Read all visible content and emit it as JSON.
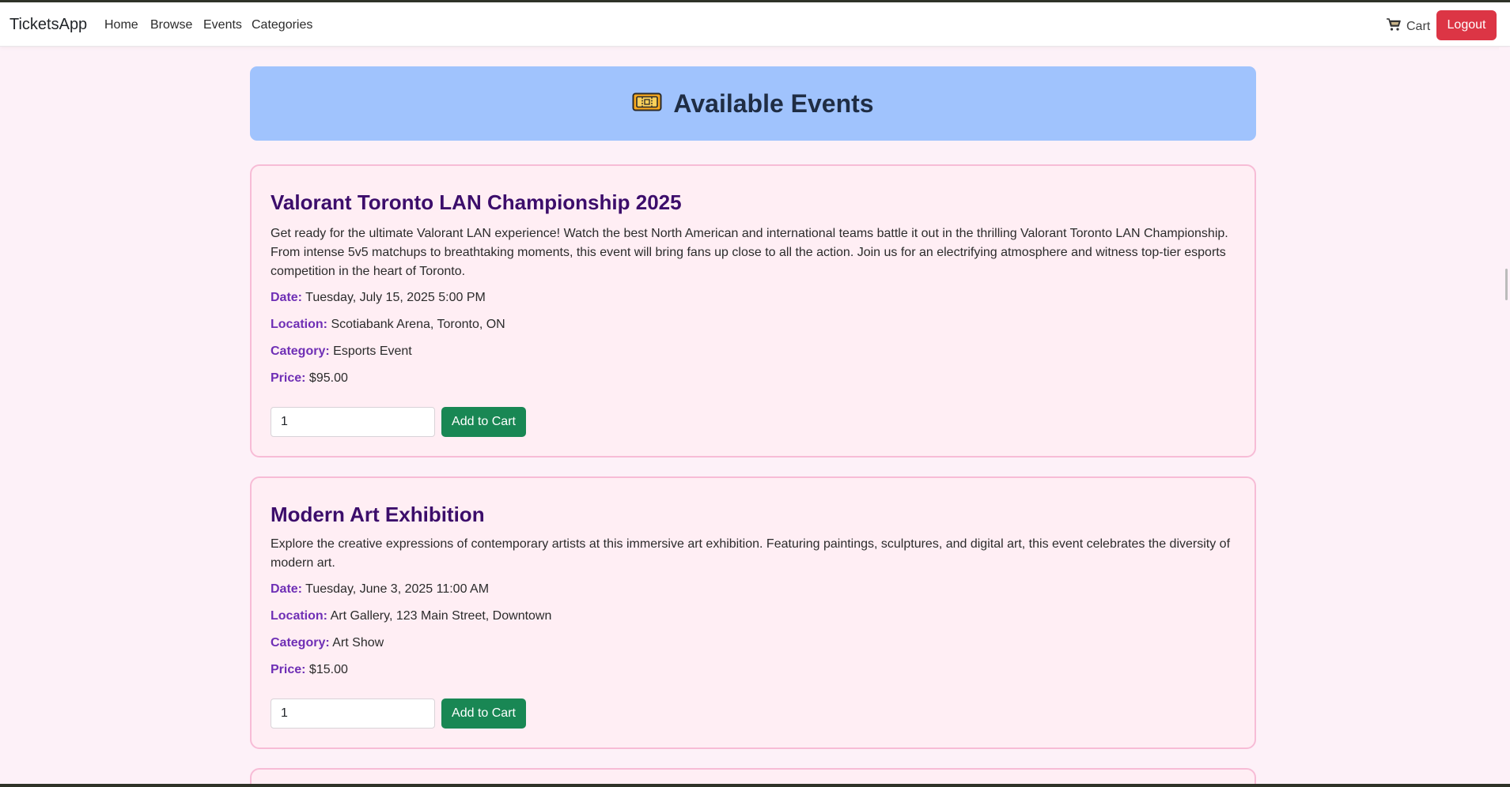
{
  "nav": {
    "brand": "TicketsApp",
    "links": [
      "Home",
      "Browse",
      "Events",
      "Categories"
    ],
    "cart_label": "Cart",
    "cart_icon": "cart-icon",
    "logout_label": "Logout"
  },
  "hero": {
    "icon": "ticket-icon",
    "title": "Available Events"
  },
  "labels": {
    "date": "Date:",
    "location": "Location:",
    "category": "Category:",
    "price": "Price:",
    "add_to_cart": "Add to Cart"
  },
  "events": [
    {
      "title": "Valorant Toronto LAN Championship 2025",
      "description": "Get ready for the ultimate Valorant LAN experience! Watch the best North American and international teams battle it out in the thrilling Valorant Toronto LAN Championship. From intense 5v5 matchups to breathtaking moments, this event will bring fans up close to all the action. Join us for an electrifying atmosphere and witness top-tier esports competition in the heart of Toronto.",
      "date": "Tuesday, July 15, 2025 5:00 PM",
      "location": "Scotiabank Arena, Toronto, ON",
      "category": "Esports Event",
      "price": "$95.00",
      "quantity": "1"
    },
    {
      "title": "Modern Art Exhibition",
      "description": "Explore the creative expressions of contemporary artists at this immersive art exhibition. Featuring paintings, sculptures, and digital art, this event celebrates the diversity of modern art.",
      "date": "Tuesday, June 3, 2025 11:00 AM",
      "location": "Art Gallery, 123 Main Street, Downtown",
      "category": "Art Show",
      "price": "$15.00",
      "quantity": "1"
    }
  ],
  "colors": {
    "page_bg": "#fdf1f8",
    "hero_bg": "#a0c3fd",
    "card_bg": "#ffeef4",
    "card_border": "#f7bcd6",
    "title_color": "#3c0d6b",
    "label_color": "#6f2fb5",
    "add_button": "#198754",
    "logout_button": "#dc3545"
  }
}
